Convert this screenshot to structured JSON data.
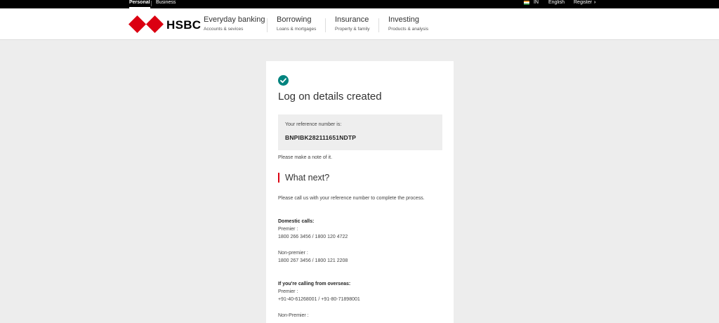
{
  "topbar": {
    "personal": "Personal",
    "business": "Business",
    "country": "IN",
    "language": "English",
    "register": "Register",
    "chevron": "›"
  },
  "header": {
    "brand": "HSBC",
    "nav": [
      {
        "title": "Everyday banking",
        "subtitle": "Accounts & sevices"
      },
      {
        "title": "Borrowing",
        "subtitle": "Loans & mortgages"
      },
      {
        "title": "Insurance",
        "subtitle": "Property & family"
      },
      {
        "title": "Investing",
        "subtitle": "Products & analysis"
      }
    ]
  },
  "card": {
    "title": "Log on details created",
    "reference_label": "Your reference number is:",
    "reference_value": "BNPIBK282111651NDTP",
    "note": "Please make a note of it.",
    "what_next": "What next?",
    "instructions": "Please call us with your reference number to complete the process.",
    "domestic_heading": "Domestic calls:",
    "domestic_premier_label": "Premier :",
    "domestic_premier_numbers": "1800 266 3456 / 1800 120 4722",
    "domestic_nonpremier_label": "Non-premier :",
    "domestic_nonpremier_numbers": "1800 267 3456 / 1800 121 2208",
    "overseas_heading": "If you're calling from overseas:",
    "overseas_premier_label": "Premier :",
    "overseas_premier_numbers": "+91-40-61268001 / +91-80-71898001",
    "overseas_nonpremier_label": "Non-Premier :"
  },
  "colors": {
    "brand_red": "#db0011",
    "success_teal": "#00847f",
    "topbar": "#000000"
  },
  "icons": {
    "logo": "hsbc-hexagon-logo",
    "success": "check-circle-icon",
    "flag": "india-flag-icon"
  }
}
